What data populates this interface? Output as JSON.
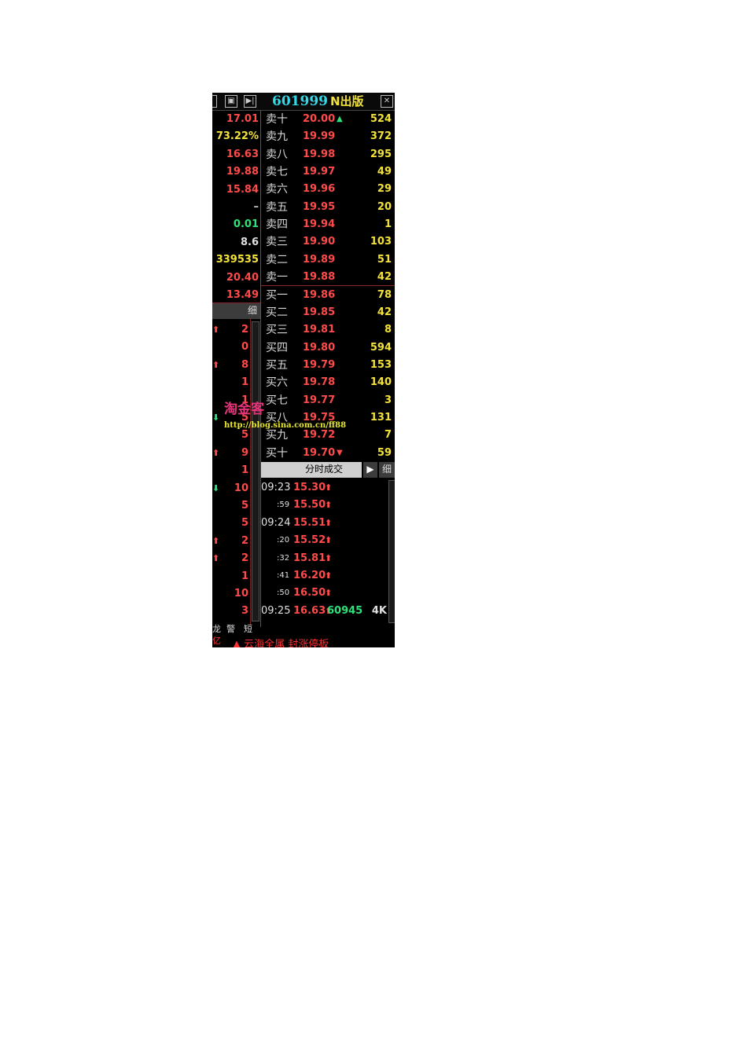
{
  "title_bar": {
    "code": "601999",
    "name": "N出版"
  },
  "left_values": [
    "17.01",
    "73.22%",
    "16.63",
    "19.88",
    "15.84",
    "–",
    "0.01",
    "8.6",
    "339535",
    "20.40",
    "13.49"
  ],
  "left_value_colors": [
    "#ff4a4a",
    "#f2e23a",
    "#ff4a4a",
    "#ff4a4a",
    "#ff4a4a",
    "#cccccc",
    "#2ee27a",
    "#e0e0e0",
    "#f2e23a",
    "#ff4a4a",
    "#ff4a4a"
  ],
  "left_detail_label": "细",
  "left_ticks": [
    {
      "arrow": "up",
      "value": "2"
    },
    {
      "arrow": "",
      "value": "0"
    },
    {
      "arrow": "up",
      "value": "8"
    },
    {
      "arrow": "",
      "value": "1"
    },
    {
      "arrow": "",
      "value": "1"
    },
    {
      "arrow": "down",
      "value": "5"
    },
    {
      "arrow": "",
      "value": "5"
    },
    {
      "arrow": "up",
      "value": "9"
    },
    {
      "arrow": "",
      "value": "1"
    },
    {
      "arrow": "down",
      "value": "10"
    },
    {
      "arrow": "",
      "value": "5"
    },
    {
      "arrow": "",
      "value": "5"
    },
    {
      "arrow": "up",
      "value": "2"
    },
    {
      "arrow": "up",
      "value": "2"
    },
    {
      "arrow": "",
      "value": "1"
    },
    {
      "arrow": "",
      "value": "10"
    },
    {
      "arrow": "",
      "value": "3"
    }
  ],
  "sell_orders": [
    {
      "label": "卖十",
      "price": "20.00",
      "qty": "524",
      "arrow": "up"
    },
    {
      "label": "卖九",
      "price": "19.99",
      "qty": "372"
    },
    {
      "label": "卖八",
      "price": "19.98",
      "qty": "295"
    },
    {
      "label": "卖七",
      "price": "19.97",
      "qty": "49"
    },
    {
      "label": "卖六",
      "price": "19.96",
      "qty": "29"
    },
    {
      "label": "卖五",
      "price": "19.95",
      "qty": "20"
    },
    {
      "label": "卖四",
      "price": "19.94",
      "qty": "1"
    },
    {
      "label": "卖三",
      "price": "19.90",
      "qty": "103"
    },
    {
      "label": "卖二",
      "price": "19.89",
      "qty": "51"
    },
    {
      "label": "卖一",
      "price": "19.88",
      "qty": "42"
    }
  ],
  "buy_orders": [
    {
      "label": "买一",
      "price": "19.86",
      "qty": "78"
    },
    {
      "label": "买二",
      "price": "19.85",
      "qty": "42"
    },
    {
      "label": "买三",
      "price": "19.81",
      "qty": "8"
    },
    {
      "label": "买四",
      "price": "19.80",
      "qty": "594"
    },
    {
      "label": "买五",
      "price": "19.79",
      "qty": "153"
    },
    {
      "label": "买六",
      "price": "19.78",
      "qty": "140"
    },
    {
      "label": "买七",
      "price": "19.77",
      "qty": "3"
    },
    {
      "label": "买八",
      "price": "19.75",
      "qty": "131"
    },
    {
      "label": "买九",
      "price": "19.72",
      "qty": "7"
    },
    {
      "label": "买十",
      "price": "19.70",
      "qty": "59",
      "arrow": "down"
    }
  ],
  "time_sales_header": {
    "label": "分时成交",
    "detail": "细"
  },
  "trades": [
    {
      "time": "09:23",
      "small": false,
      "price": "15.30"
    },
    {
      "time": ":59",
      "small": true,
      "price": "15.50"
    },
    {
      "time": "09:24",
      "small": false,
      "price": "15.51"
    },
    {
      "time": ":20",
      "small": true,
      "price": "15.52"
    },
    {
      "time": ":32",
      "small": true,
      "price": "15.81"
    },
    {
      "time": ":41",
      "small": true,
      "price": "16.20"
    },
    {
      "time": ":50",
      "small": true,
      "price": "16.50"
    },
    {
      "time": "09:25",
      "small": false,
      "price": "16.63",
      "volume": "60945",
      "unit": "4K"
    }
  ],
  "watermark": {
    "name": "淘金客",
    "url": "http://blog.sina.com.cn/ff88"
  },
  "footer": {
    "tabs": [
      "龙",
      "警",
      "短"
    ],
    "left_text": "亿",
    "alert_text": "云海全属 封涨停板"
  },
  "colors": {
    "price_red": "#ff4a4a",
    "qty_yellow": "#f2e23a",
    "code_cyan": "#33d9e8",
    "up_green": "#2ee27a",
    "grid_red": "#b03030"
  }
}
